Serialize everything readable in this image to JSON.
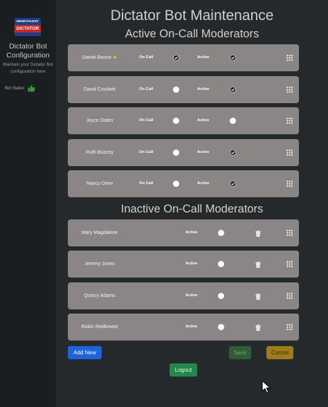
{
  "sidebar": {
    "logo_top": "BENEVOLENT",
    "logo_bottom": "DICTATOR",
    "title": "Dictator Bot Configuration",
    "description": "Maintain your Dictator Bot configuration here",
    "status_label": "Bot Status:",
    "status_icon": "thumbs-up-icon",
    "status_color": "#2e9c3a"
  },
  "header": {
    "title": "Dictator Bot Maintenance",
    "active_heading": "Active On-Call Moderators",
    "inactive_heading": "Inactive On-Call Moderators"
  },
  "labels": {
    "on_call": "On Call",
    "active": "Active"
  },
  "active_moderators": [
    {
      "name": "Daniel Boone",
      "star": "★",
      "on_call": true,
      "active": true
    },
    {
      "name": "David Crockett",
      "star": "",
      "on_call": false,
      "active": true
    },
    {
      "name": "Joyce Oates",
      "star": "",
      "on_call": false,
      "active": false
    },
    {
      "name": "Ruth Buzzey",
      "star": "",
      "on_call": false,
      "active": true
    },
    {
      "name": "Nancy Drew",
      "star": "",
      "on_call": false,
      "active": true
    }
  ],
  "inactive_moderators": [
    {
      "name": "Mary Magdalene",
      "active": false
    },
    {
      "name": "Jeremy Jones",
      "active": false
    },
    {
      "name": "Quincy Adams",
      "active": false
    },
    {
      "name": "Robin Redbreast",
      "active": false
    }
  ],
  "buttons": {
    "add_new": "Add New",
    "save": "Save",
    "cancel": "Cancel",
    "logout": "Logout"
  },
  "colors": {
    "add_new": "#1e63d8",
    "save": "#2f5d39",
    "cancel": "#9c7d19",
    "logout": "#1f8a4a",
    "check_fill": "#1a2a44"
  }
}
